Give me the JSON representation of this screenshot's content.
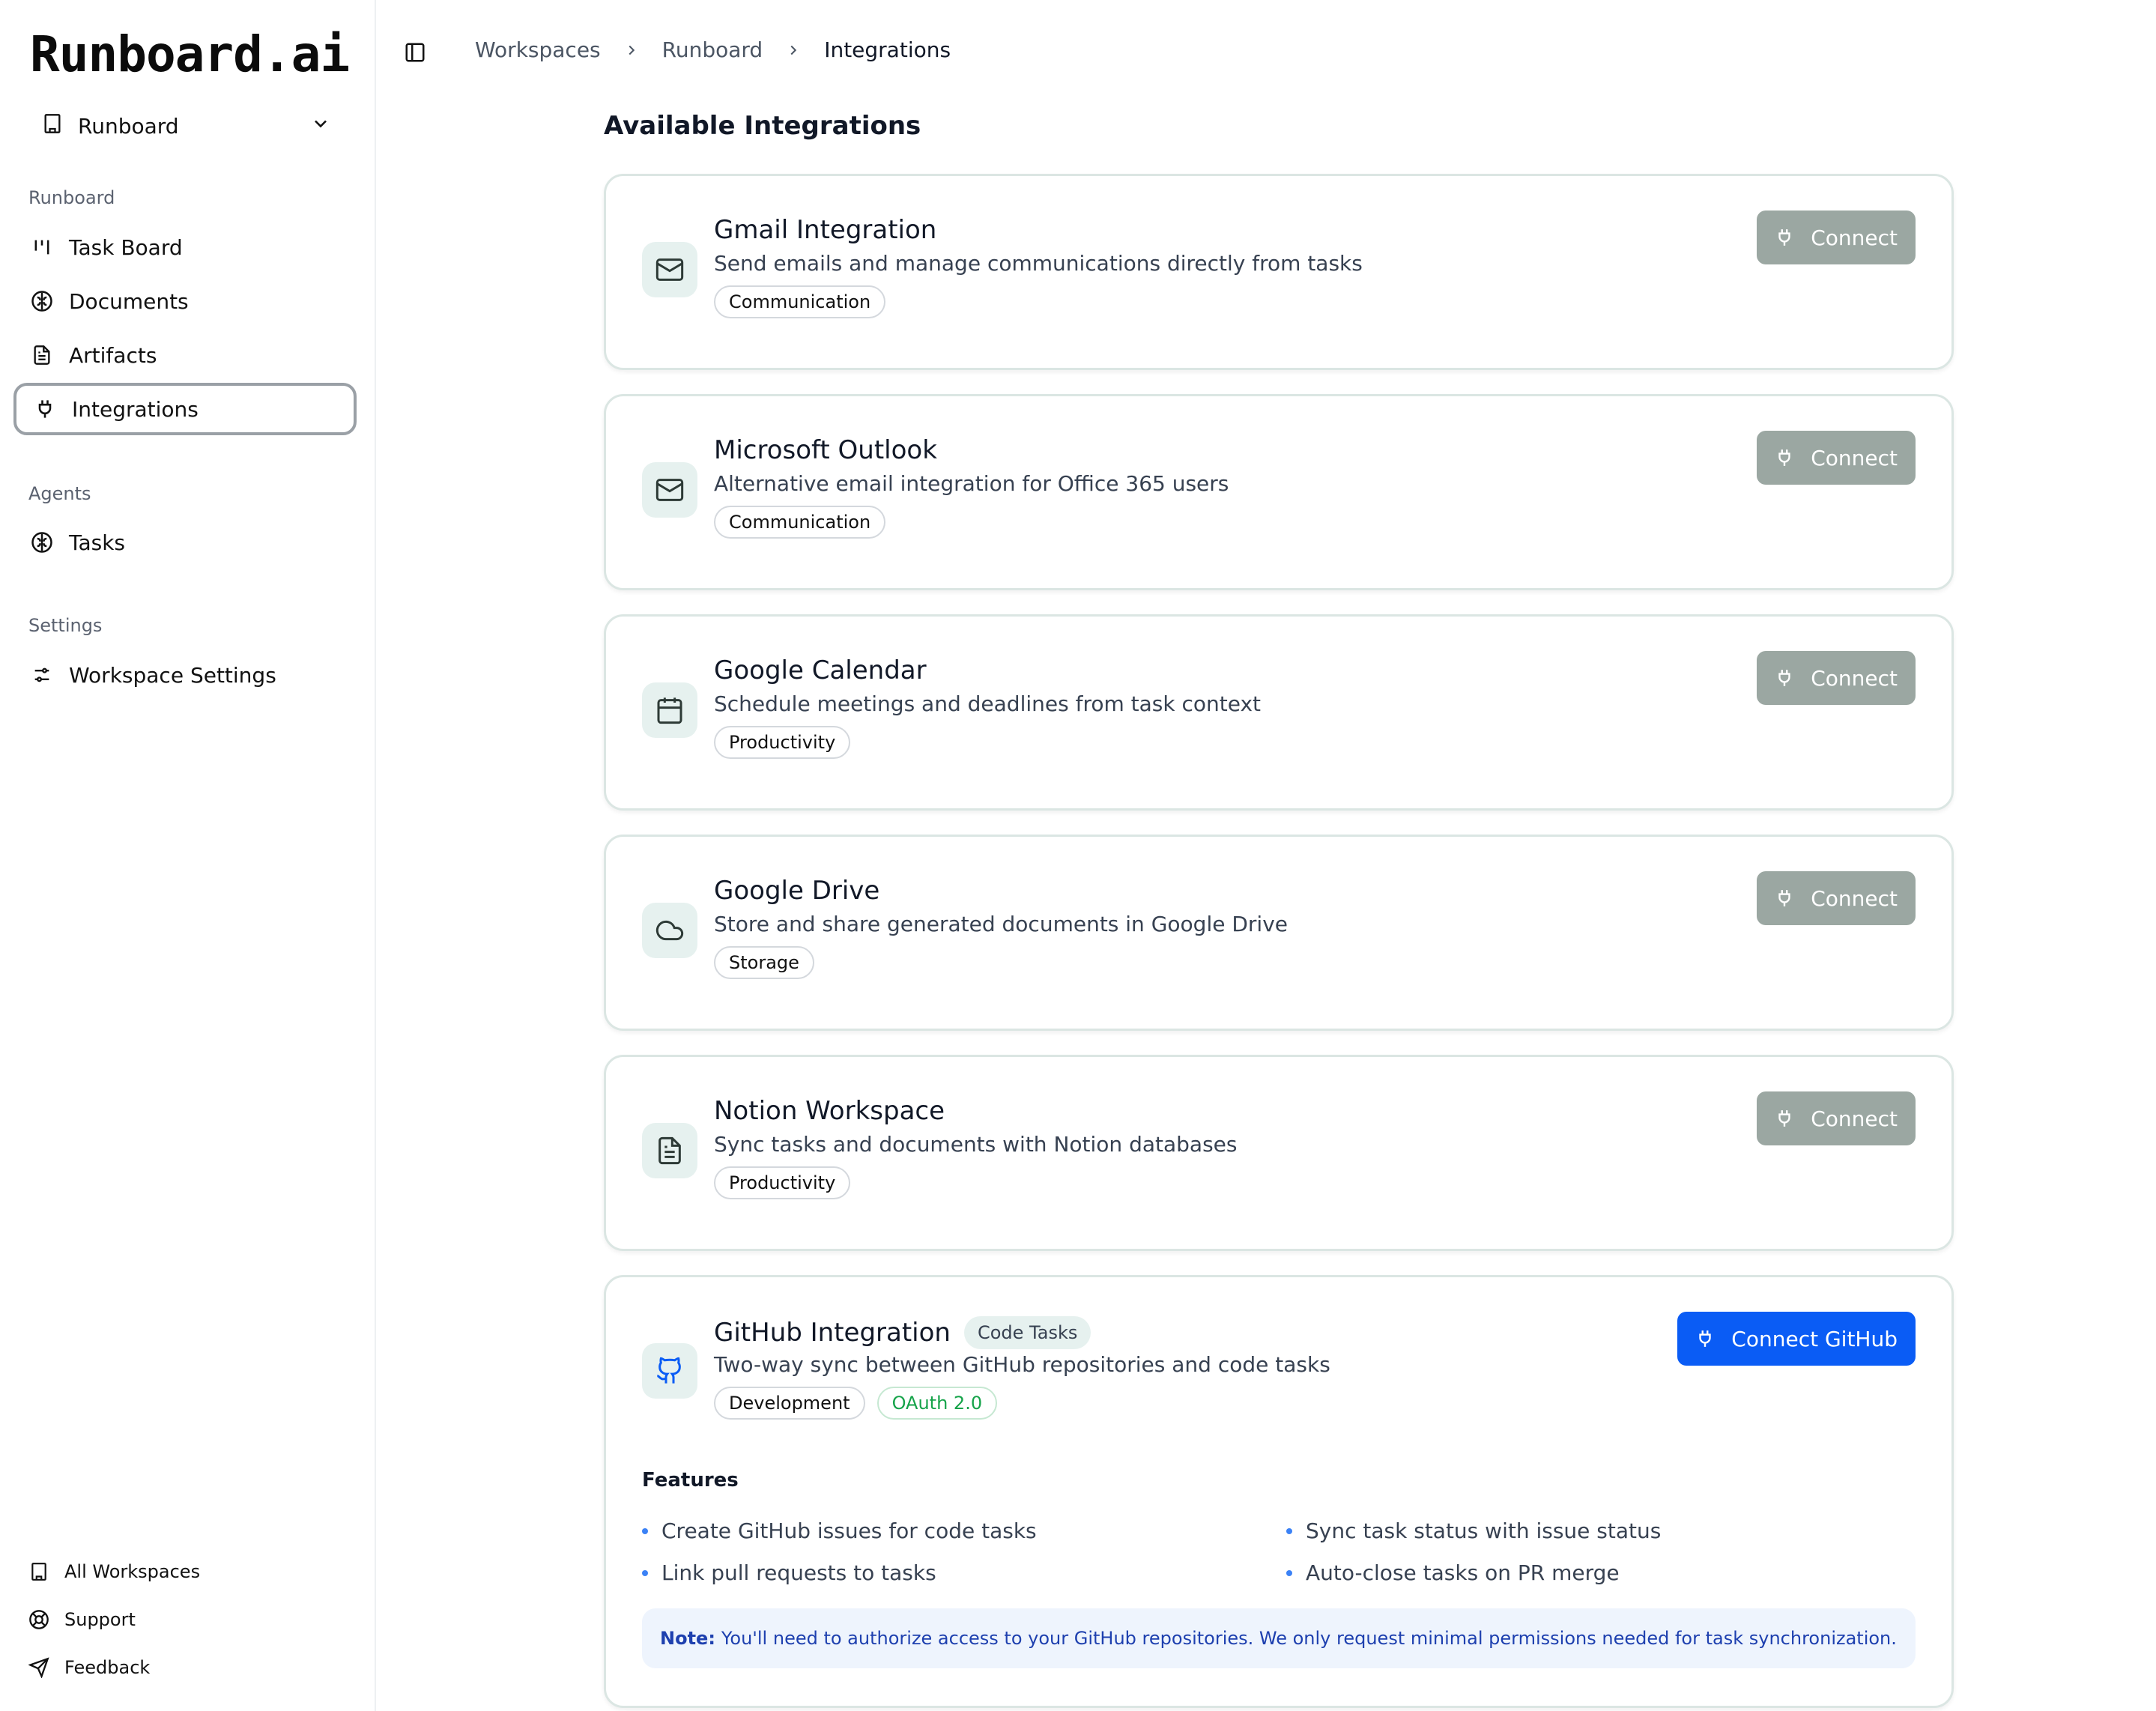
{
  "sidebar": {
    "logo": "Runboard.ai",
    "workspace": "Runboard",
    "sections": [
      {
        "label": "Runboard",
        "items": [
          {
            "label": "Task Board",
            "icon": "kanban-icon"
          },
          {
            "label": "Documents",
            "icon": "brain-icon"
          },
          {
            "label": "Artifacts",
            "icon": "file-text-icon"
          },
          {
            "label": "Integrations",
            "icon": "plug-icon",
            "active": true
          }
        ]
      },
      {
        "label": "Agents",
        "items": [
          {
            "label": "Tasks",
            "icon": "brain-icon"
          }
        ]
      },
      {
        "label": "Settings",
        "items": [
          {
            "label": "Workspace Settings",
            "icon": "sliders-icon"
          }
        ]
      }
    ],
    "footer": [
      {
        "label": "All Workspaces",
        "icon": "building-icon"
      },
      {
        "label": "Support",
        "icon": "lifebuoy-icon"
      },
      {
        "label": "Feedback",
        "icon": "send-icon"
      }
    ]
  },
  "breadcrumb": [
    "Workspaces",
    "Runboard",
    "Integrations"
  ],
  "page_title": "Available Integrations",
  "connect_label": "Connect",
  "integrations": [
    {
      "title": "Gmail Integration",
      "description": "Send emails and manage communications directly from tasks",
      "tags": [
        "Communication"
      ],
      "icon": "mail-icon"
    },
    {
      "title": "Microsoft Outlook",
      "description": "Alternative email integration for Office 365 users",
      "tags": [
        "Communication"
      ],
      "icon": "mail-icon"
    },
    {
      "title": "Google Calendar",
      "description": "Schedule meetings and deadlines from task context",
      "tags": [
        "Productivity"
      ],
      "icon": "calendar-icon"
    },
    {
      "title": "Google Drive",
      "description": "Store and share generated documents in Google Drive",
      "tags": [
        "Storage"
      ],
      "icon": "cloud-icon"
    },
    {
      "title": "Notion Workspace",
      "description": "Sync tasks and documents with Notion databases",
      "tags": [
        "Productivity"
      ],
      "icon": "file-text-icon"
    }
  ],
  "github": {
    "title": "GitHub Integration",
    "badge": "Code Tasks",
    "description": "Two-way sync between GitHub repositories and code tasks",
    "tags": [
      "Development",
      "OAuth 2.0"
    ],
    "button": "Connect GitHub",
    "features_title": "Features",
    "features": [
      "Create GitHub issues for code tasks",
      "Sync task status with issue status",
      "Link pull requests to tasks",
      "Auto-close tasks on PR merge"
    ],
    "note_label": "Note:",
    "note_text": "You'll need to authorize access to your GitHub repositories. We only request minimal permissions needed for task synchronization."
  },
  "colors": {
    "accent": "#0a5cf5",
    "connect_disabled": "#9ba7a2",
    "icon_bg": "#e6f1ef",
    "oauth": "#16a34a"
  }
}
